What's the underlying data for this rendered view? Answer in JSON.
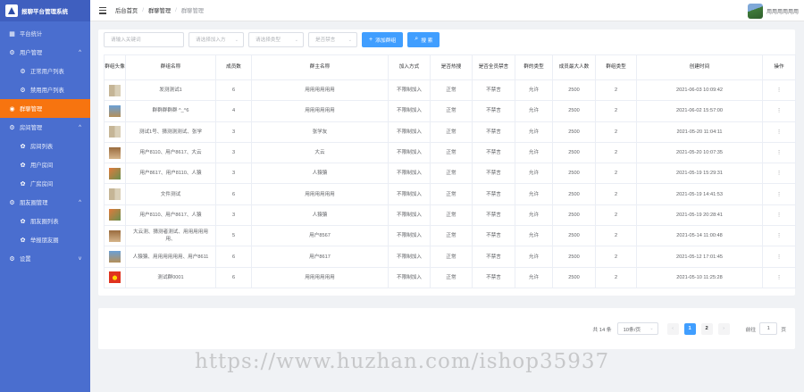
{
  "app": {
    "title": "报聊平台管理系统"
  },
  "sidebar": {
    "items": [
      {
        "label": "平台统计",
        "icon": "chart-icon"
      },
      {
        "label": "用户管理",
        "icon": "gear-icon",
        "arrow": "^"
      },
      {
        "label": "正常用户列表",
        "icon": "gear-icon"
      },
      {
        "label": "禁用用户列表",
        "icon": "gear-icon"
      },
      {
        "label": "群聊管理",
        "icon": "chat-icon"
      },
      {
        "label": "房间管理",
        "icon": "gear-icon",
        "arrow": "^"
      },
      {
        "label": "房间列表",
        "icon": "cluster-icon"
      },
      {
        "label": "用户房间",
        "icon": "cluster-icon"
      },
      {
        "label": "广房房间",
        "icon": "cluster-icon"
      },
      {
        "label": "朋友圈管理",
        "icon": "gear-icon",
        "arrow": "^"
      },
      {
        "label": "朋友圈列表",
        "icon": "cluster-icon"
      },
      {
        "label": "举报朋友圈",
        "icon": "cluster-icon"
      },
      {
        "label": "设置",
        "icon": "gear-icon",
        "arrow": "v"
      }
    ]
  },
  "header": {
    "breadcrumb": [
      "后台首页",
      "群聊管理",
      "群聊管理"
    ],
    "username": "用用用用用用"
  },
  "filters": {
    "keyword_placeholder": "请输入关键词",
    "join_placeholder": "请选择加入方",
    "type_placeholder": "请选择类型",
    "ban_placeholder": "是否禁言",
    "add_label": "添加群组",
    "search_label": "搜 索"
  },
  "table": {
    "headers": [
      "群组头像",
      "群组名称",
      "成员数",
      "群主名称",
      "加入方式",
      "是否热搜",
      "是否全员禁言",
      "群的类型",
      "成员最大人数",
      "群组类型",
      "创建时间",
      "操作"
    ],
    "rows": [
      {
        "thumb": "grid4",
        "name": "发测测试1",
        "count": "6",
        "owner": "用用用用用用",
        "join": "不限制加入",
        "hot": "正常",
        "mute": "不禁言",
        "type": "允许",
        "max": "2500",
        "gtype": "2",
        "time": "2021-06-03 10:09:42",
        "op": "⋮"
      },
      {
        "thumb": "fish",
        "name": "群群群群群 ^_^6",
        "count": "4",
        "owner": "用用用用用用",
        "join": "不限制加入",
        "hot": "正常",
        "mute": "不禁言",
        "type": "允许",
        "max": "2500",
        "gtype": "2",
        "time": "2021-06-02 15:57:00",
        "op": "⋮"
      },
      {
        "thumb": "grid4",
        "name": "测试1号、猜测测测试、张学",
        "count": "3",
        "owner": "张学友",
        "join": "不限制加入",
        "hot": "正常",
        "mute": "不禁言",
        "type": "允许",
        "max": "2500",
        "gtype": "2",
        "time": "2021-05-20 11:04:11",
        "op": "⋮"
      },
      {
        "thumb": "brown",
        "name": "用户8110、用户8617、大云",
        "count": "3",
        "owner": "大云",
        "join": "不限制加入",
        "hot": "正常",
        "mute": "不禁言",
        "type": "允许",
        "max": "2500",
        "gtype": "2",
        "time": "2021-05-20 10:07:35",
        "op": "⋮"
      },
      {
        "thumb": "mix",
        "name": "用户8617、用户8110、人猿",
        "count": "3",
        "owner": "人猿猿",
        "join": "不限制加入",
        "hot": "正常",
        "mute": "不禁言",
        "type": "允许",
        "max": "2500",
        "gtype": "2",
        "time": "2021-05-19 15:29:31",
        "op": "⋮"
      },
      {
        "thumb": "grid4",
        "name": "文件测试",
        "count": "6",
        "owner": "用用用用用用",
        "join": "不限制加入",
        "hot": "正常",
        "mute": "不禁言",
        "type": "允许",
        "max": "2500",
        "gtype": "2",
        "time": "2021-05-19 14:41:53",
        "op": "⋮"
      },
      {
        "thumb": "mix",
        "name": "用户8110、用户8617、人猿",
        "count": "3",
        "owner": "人猿猿",
        "join": "不限制加入",
        "hot": "正常",
        "mute": "不禁言",
        "type": "允许",
        "max": "2500",
        "gtype": "2",
        "time": "2021-05-19 20:28:41",
        "op": "⋮"
      },
      {
        "thumb": "brown",
        "name": "大云测、猜测者测试、用用用用用用、",
        "count": "5",
        "owner": "用户8567",
        "join": "不限制加入",
        "hot": "正常",
        "mute": "不禁言",
        "type": "允许",
        "max": "2500",
        "gtype": "2",
        "time": "2021-05-14 11:00:48",
        "op": "⋮"
      },
      {
        "thumb": "fish",
        "name": "人猿猿、用用用用用用、用户8611",
        "count": "6",
        "owner": "用户8617",
        "join": "不限制加入",
        "hot": "正常",
        "mute": "不禁言",
        "type": "允许",
        "max": "2500",
        "gtype": "2",
        "time": "2021-05-12 17:01:45",
        "op": "⋮"
      },
      {
        "thumb": "red",
        "name": "测试群0001",
        "count": "6",
        "owner": "用用用用用用",
        "join": "不限制加入",
        "hot": "正常",
        "mute": "不禁言",
        "type": "允许",
        "max": "2500",
        "gtype": "2",
        "time": "2021-05-10 11:25:28",
        "op": "⋮"
      }
    ]
  },
  "pagination": {
    "total": "共 14 条",
    "page_size": "10条/页",
    "pages": [
      "1",
      "2"
    ],
    "prev": "‹",
    "next": "›",
    "goto_label": "前往",
    "current": "1",
    "page_unit": "页"
  },
  "watermark": "https://www.huzhan.com/ishop35937",
  "colors": {
    "sidebar": "#4a6ecf",
    "active": "#f7740f",
    "primary": "#409eff"
  }
}
